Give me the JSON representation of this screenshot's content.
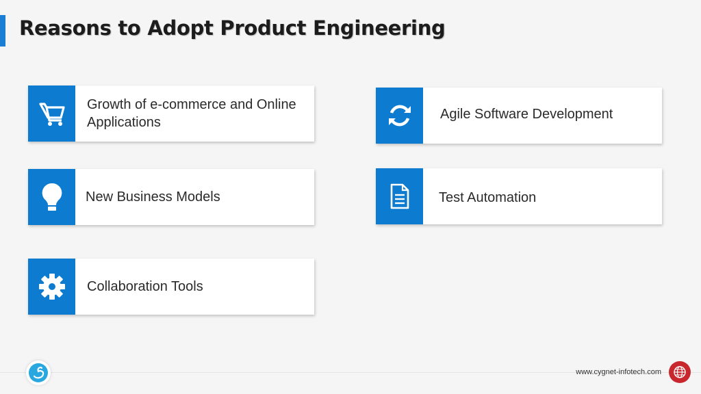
{
  "slide": {
    "title": "Reasons to Adopt Product Engineering"
  },
  "cards": [
    {
      "label": "Growth of e-commerce and Online Applications",
      "icon": "shopping-cart-icon"
    },
    {
      "label": "Agile Software Development",
      "icon": "refresh-icon"
    },
    {
      "label": "New Business Models",
      "icon": "lightbulb-icon"
    },
    {
      "label": "Test Automation",
      "icon": "document-icon"
    },
    {
      "label": "Collaboration Tools",
      "icon": "gear-icon"
    }
  ],
  "footer": {
    "website": "www.cygnet-infotech.com"
  },
  "colors": {
    "accent": "#1a7fd4",
    "icon_bg": "#0d7bd0",
    "globe": "#c8282d"
  }
}
